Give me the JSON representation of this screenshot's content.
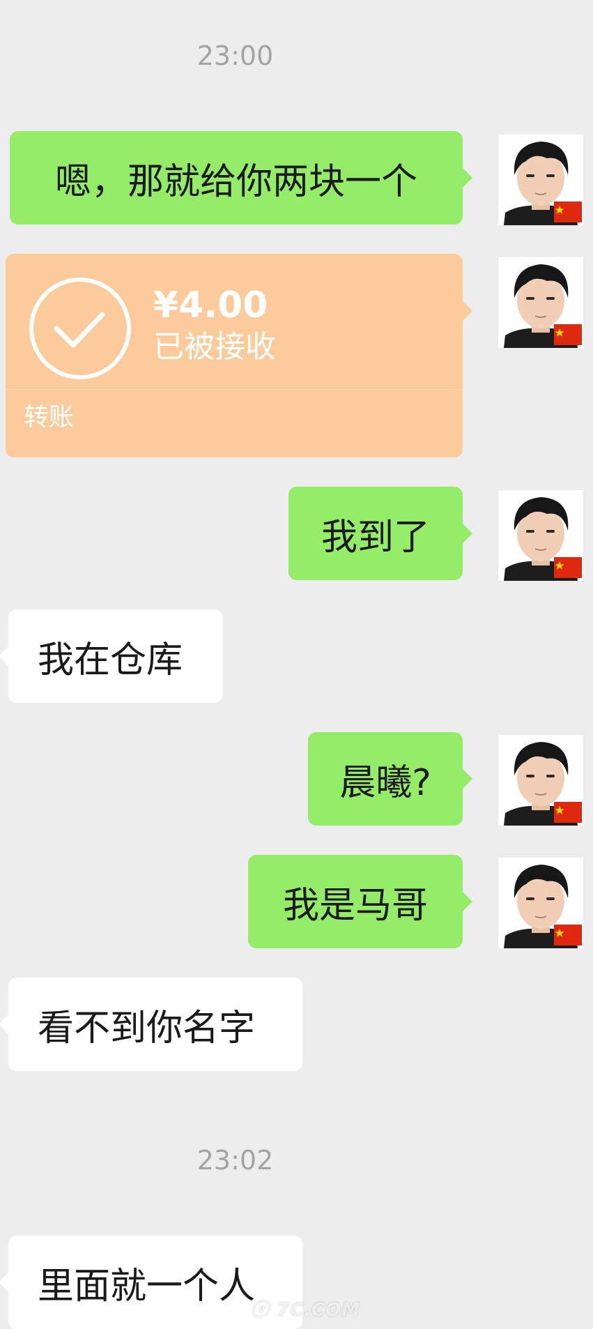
{
  "timestamps": [
    "23:00",
    "23:02"
  ],
  "messages": [
    {
      "text": "嗯，那就给你两块一个"
    },
    {
      "text": "我到了"
    },
    {
      "text": "我在仓库"
    },
    {
      "text": "晨曦?"
    },
    {
      "text": "我是马哥"
    },
    {
      "text": "看不到你名字"
    },
    {
      "text": "里面就一个人"
    }
  ],
  "transfer": {
    "amount": "¥4.00",
    "status": "已被接收",
    "label": "转账"
  },
  "colors": {
    "background": "#ededed",
    "my_bubble": "#95ec69",
    "their_bubble": "#ffffff",
    "transfer_bubble": "#fbcb9c",
    "timestamp": "#a3a3a3"
  },
  "icons": {
    "transfer_status": "check-circle-icon",
    "avatar_badge": "china-flag-icon"
  }
}
